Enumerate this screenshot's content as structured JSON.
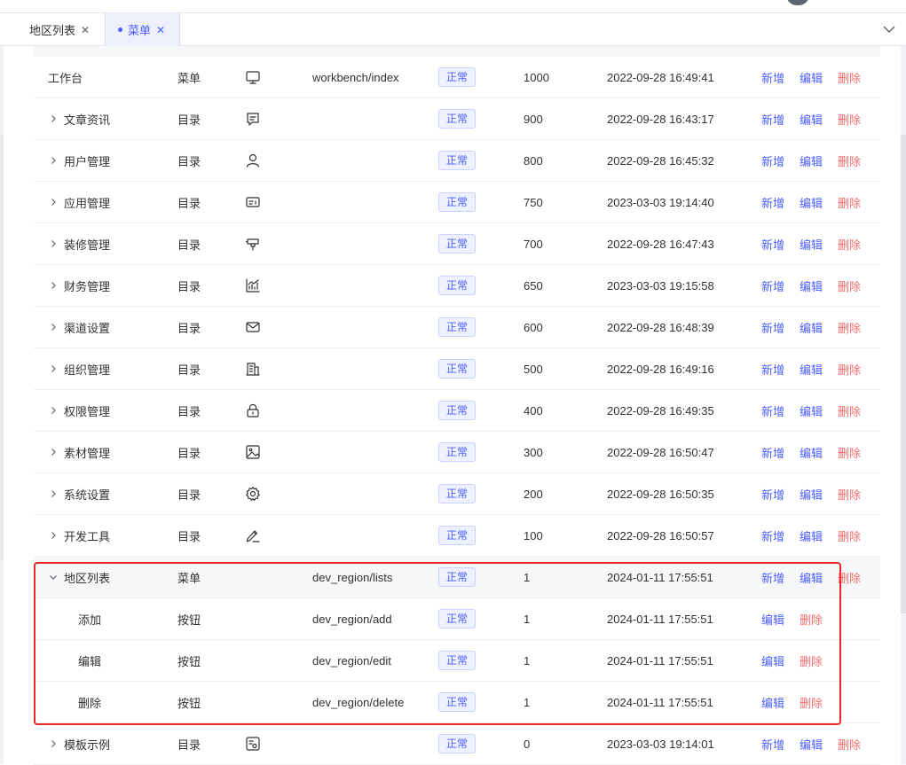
{
  "tabs": [
    {
      "label": "地区列表",
      "active": false
    },
    {
      "label": "菜单",
      "active": true
    }
  ],
  "colors": {
    "accent": "#4a5dff",
    "danger": "#f56c6c",
    "highlight_border": "#e8292a"
  },
  "rows": [
    {
      "name": "工作台",
      "type": "菜单",
      "icon": "monitor-icon",
      "path": "workbench/index",
      "status": "正常",
      "sort": "1000",
      "time": "2022-09-28 16:49:41",
      "actions": [
        "新增",
        "编辑",
        "删除"
      ]
    },
    {
      "name": "文章资讯",
      "type": "目录",
      "icon": "message-icon",
      "path": "",
      "status": "正常",
      "sort": "900",
      "time": "2022-09-28 16:43:17",
      "actions": [
        "新增",
        "编辑",
        "删除"
      ]
    },
    {
      "name": "用户管理",
      "type": "目录",
      "icon": "user-icon",
      "path": "",
      "status": "正常",
      "sort": "800",
      "time": "2022-09-28 16:45:32",
      "actions": [
        "新增",
        "编辑",
        "删除"
      ]
    },
    {
      "name": "应用管理",
      "type": "目录",
      "icon": "card-icon",
      "path": "",
      "status": "正常",
      "sort": "750",
      "time": "2023-03-03 19:14:40",
      "actions": [
        "新增",
        "编辑",
        "删除"
      ]
    },
    {
      "name": "装修管理",
      "type": "目录",
      "icon": "brush-icon",
      "path": "",
      "status": "正常",
      "sort": "700",
      "time": "2022-09-28 16:47:43",
      "actions": [
        "新增",
        "编辑",
        "删除"
      ]
    },
    {
      "name": "财务管理",
      "type": "目录",
      "icon": "chart-icon",
      "path": "",
      "status": "正常",
      "sort": "650",
      "time": "2023-03-03 19:15:58",
      "actions": [
        "新增",
        "编辑",
        "删除"
      ]
    },
    {
      "name": "渠道设置",
      "type": "目录",
      "icon": "mail-icon",
      "path": "",
      "status": "正常",
      "sort": "600",
      "time": "2022-09-28 16:48:39",
      "actions": [
        "新增",
        "编辑",
        "删除"
      ]
    },
    {
      "name": "组织管理",
      "type": "目录",
      "icon": "building-icon",
      "path": "",
      "status": "正常",
      "sort": "500",
      "time": "2022-09-28 16:49:16",
      "actions": [
        "新增",
        "编辑",
        "删除"
      ]
    },
    {
      "name": "权限管理",
      "type": "目录",
      "icon": "lock-icon",
      "path": "",
      "status": "正常",
      "sort": "400",
      "time": "2022-09-28 16:49:35",
      "actions": [
        "新增",
        "编辑",
        "删除"
      ]
    },
    {
      "name": "素材管理",
      "type": "目录",
      "icon": "image-icon",
      "path": "",
      "status": "正常",
      "sort": "300",
      "time": "2022-09-28 16:50:47",
      "actions": [
        "新增",
        "编辑",
        "删除"
      ]
    },
    {
      "name": "系统设置",
      "type": "目录",
      "icon": "gear-icon",
      "path": "",
      "status": "正常",
      "sort": "200",
      "time": "2022-09-28 16:50:35",
      "actions": [
        "新增",
        "编辑",
        "删除"
      ]
    },
    {
      "name": "开发工具",
      "type": "目录",
      "icon": "pen-icon",
      "path": "",
      "status": "正常",
      "sort": "100",
      "time": "2022-09-28 16:50:57",
      "actions": [
        "新增",
        "编辑",
        "删除"
      ]
    },
    {
      "name": "地区列表",
      "type": "菜单",
      "icon": "",
      "path": "dev_region/lists",
      "status": "正常",
      "sort": "1",
      "time": "2024-01-11 17:55:51",
      "actions": [
        "新增",
        "编辑",
        "删除"
      ]
    },
    {
      "name": "添加",
      "type": "按钮",
      "icon": "",
      "path": "dev_region/add",
      "status": "正常",
      "sort": "1",
      "time": "2024-01-11 17:55:51",
      "actions": [
        "编辑",
        "删除"
      ]
    },
    {
      "name": "编辑",
      "type": "按钮",
      "icon": "",
      "path": "dev_region/edit",
      "status": "正常",
      "sort": "1",
      "time": "2024-01-11 17:55:51",
      "actions": [
        "编辑",
        "删除"
      ]
    },
    {
      "name": "删除",
      "type": "按钮",
      "icon": "",
      "path": "dev_region/delete",
      "status": "正常",
      "sort": "1",
      "time": "2024-01-11 17:55:51",
      "actions": [
        "编辑",
        "删除"
      ]
    },
    {
      "name": "模板示例",
      "type": "目录",
      "icon": "template-icon",
      "path": "",
      "status": "正常",
      "sort": "0",
      "time": "2023-03-03 19:14:01",
      "actions": [
        "新增",
        "编辑",
        "删除"
      ]
    }
  ]
}
